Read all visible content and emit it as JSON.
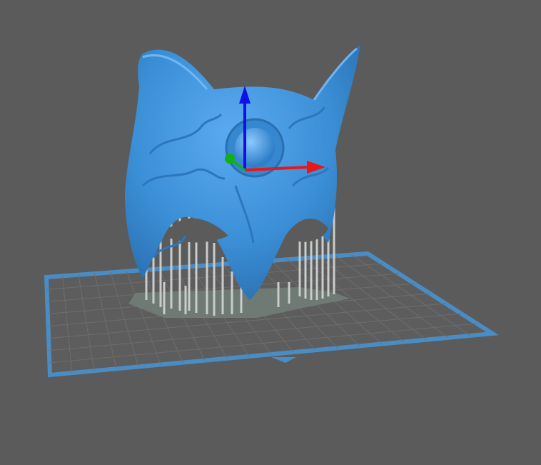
{
  "viewport": {
    "background_color": "#5b5b5b",
    "build_plate_border_color": "#4a8cc4",
    "build_plate_fill_color": "#5d5d5d",
    "grid_color": "#6e6e6e",
    "model_color": "#3b8fd6",
    "support_color": "#c9ccca",
    "raft_color": "#6f7a74"
  },
  "gizmo": {
    "z_axis_color": "#1010e8",
    "x_axis_color": "#e81818",
    "y_axis_color": "#12b012"
  }
}
